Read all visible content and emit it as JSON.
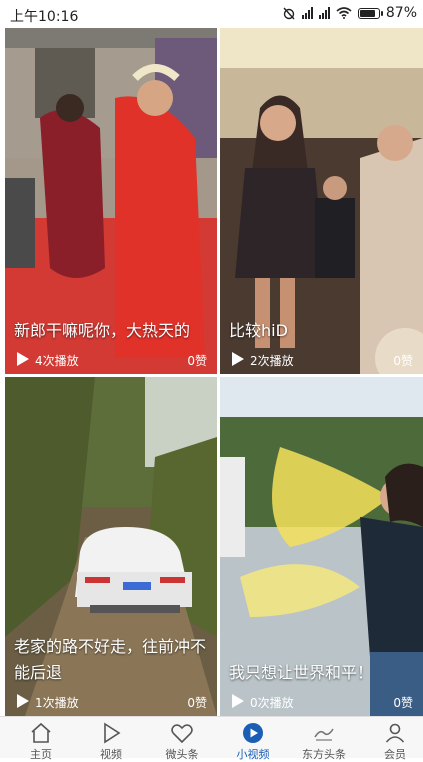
{
  "status": {
    "time": "上午10:16",
    "battery": "87%",
    "battery_level": 0.87
  },
  "cards": [
    {
      "title": "新郎干嘛呢你，大热天的",
      "plays": "4次播放",
      "likes": "0赞"
    },
    {
      "title": "比较hiD",
      "plays": "2次播放",
      "likes": "0赞"
    },
    {
      "title": "老家的路不好走，往前冲不能后退",
      "plays": "1次播放",
      "likes": "0赞"
    },
    {
      "title": "我只想让世界和平！",
      "plays": "0次播放",
      "likes": "0赞"
    }
  ],
  "nav": {
    "items": [
      {
        "label": "主页",
        "icon": "home-icon"
      },
      {
        "label": "视频",
        "icon": "play-icon"
      },
      {
        "label": "微头条",
        "icon": "heart-icon"
      },
      {
        "label": "小视频",
        "icon": "small-video-icon"
      },
      {
        "label": "东方头条",
        "icon": "brand-icon"
      },
      {
        "label": "会员",
        "icon": "person-icon"
      }
    ],
    "active_index": 3,
    "active_color": "#1a5fb4"
  }
}
